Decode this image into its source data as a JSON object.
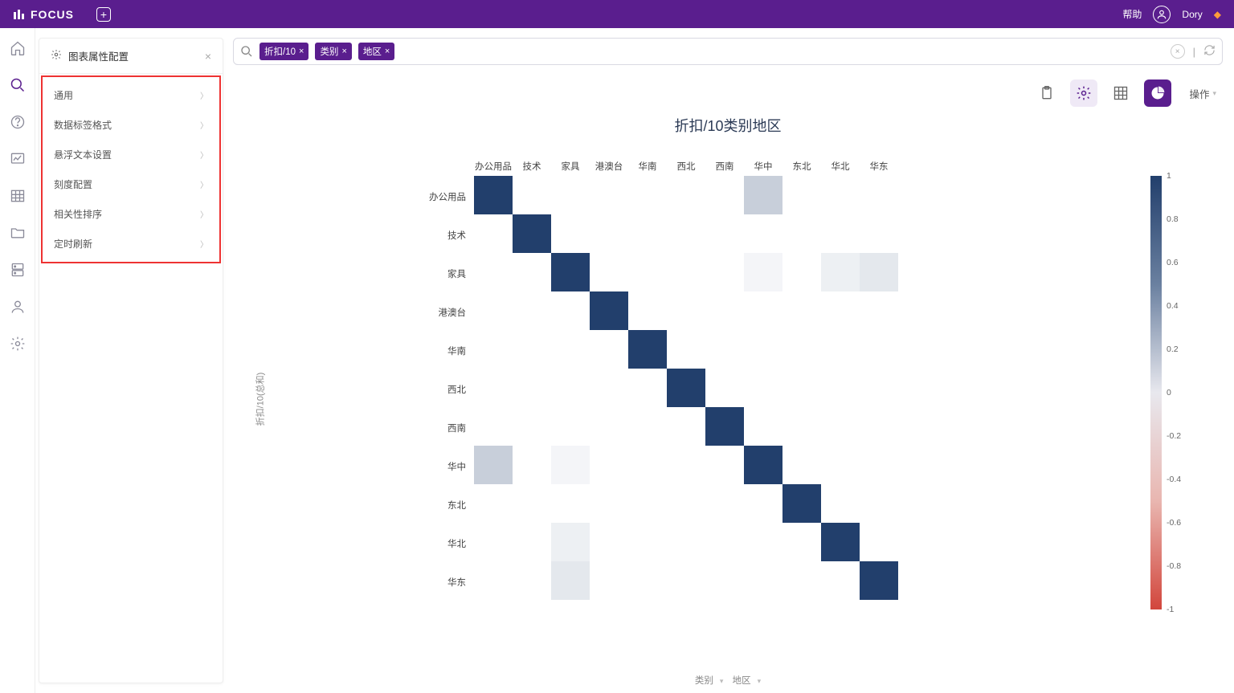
{
  "app": {
    "name": "FOCUS",
    "help": "帮助",
    "user": "Dory"
  },
  "panel": {
    "title": "图表属性配置",
    "items": [
      "通用",
      "数据标签格式",
      "悬浮文本设置",
      "刻度配置",
      "相关性排序",
      "定时刷新"
    ]
  },
  "search": {
    "chips": [
      "折扣/10",
      "类别",
      "地区"
    ]
  },
  "toolbar": {
    "operate": "操作"
  },
  "chart": {
    "title": "折扣/10类别地区",
    "ylabel": "折扣/10(总和)",
    "foot_a": "类别",
    "foot_b": "地区"
  },
  "chart_data": {
    "type": "heatmap",
    "xlabels": [
      "办公用品",
      "技术",
      "家具",
      "港澳台",
      "华南",
      "西北",
      "西南",
      "华中",
      "东北",
      "华北",
      "华东"
    ],
    "ylabels": [
      "办公用品",
      "技术",
      "家具",
      "港澳台",
      "华南",
      "西北",
      "西南",
      "华中",
      "东北",
      "华北",
      "华东"
    ],
    "legend_ticks": [
      1,
      0.8,
      0.6,
      0.4,
      0.2,
      0,
      -0.2,
      -0.4,
      -0.6,
      -0.8,
      -1
    ],
    "cells": [
      {
        "r": 0,
        "c": 0,
        "v": 1.0
      },
      {
        "r": 0,
        "c": 7,
        "v": 0.25
      },
      {
        "r": 1,
        "c": 1,
        "v": 1.0
      },
      {
        "r": 2,
        "c": 2,
        "v": 1.0
      },
      {
        "r": 2,
        "c": 7,
        "v": 0.05
      },
      {
        "r": 2,
        "c": 9,
        "v": 0.08
      },
      {
        "r": 2,
        "c": 10,
        "v": 0.12
      },
      {
        "r": 3,
        "c": 3,
        "v": 1.0
      },
      {
        "r": 4,
        "c": 4,
        "v": 1.0
      },
      {
        "r": 5,
        "c": 5,
        "v": 1.0
      },
      {
        "r": 6,
        "c": 6,
        "v": 1.0
      },
      {
        "r": 7,
        "c": 0,
        "v": 0.25
      },
      {
        "r": 7,
        "c": 2,
        "v": 0.05
      },
      {
        "r": 7,
        "c": 7,
        "v": 1.0
      },
      {
        "r": 8,
        "c": 8,
        "v": 1.0
      },
      {
        "r": 9,
        "c": 2,
        "v": 0.08
      },
      {
        "r": 9,
        "c": 9,
        "v": 1.0
      },
      {
        "r": 10,
        "c": 2,
        "v": 0.12
      },
      {
        "r": 10,
        "c": 10,
        "v": 1.0
      }
    ]
  }
}
